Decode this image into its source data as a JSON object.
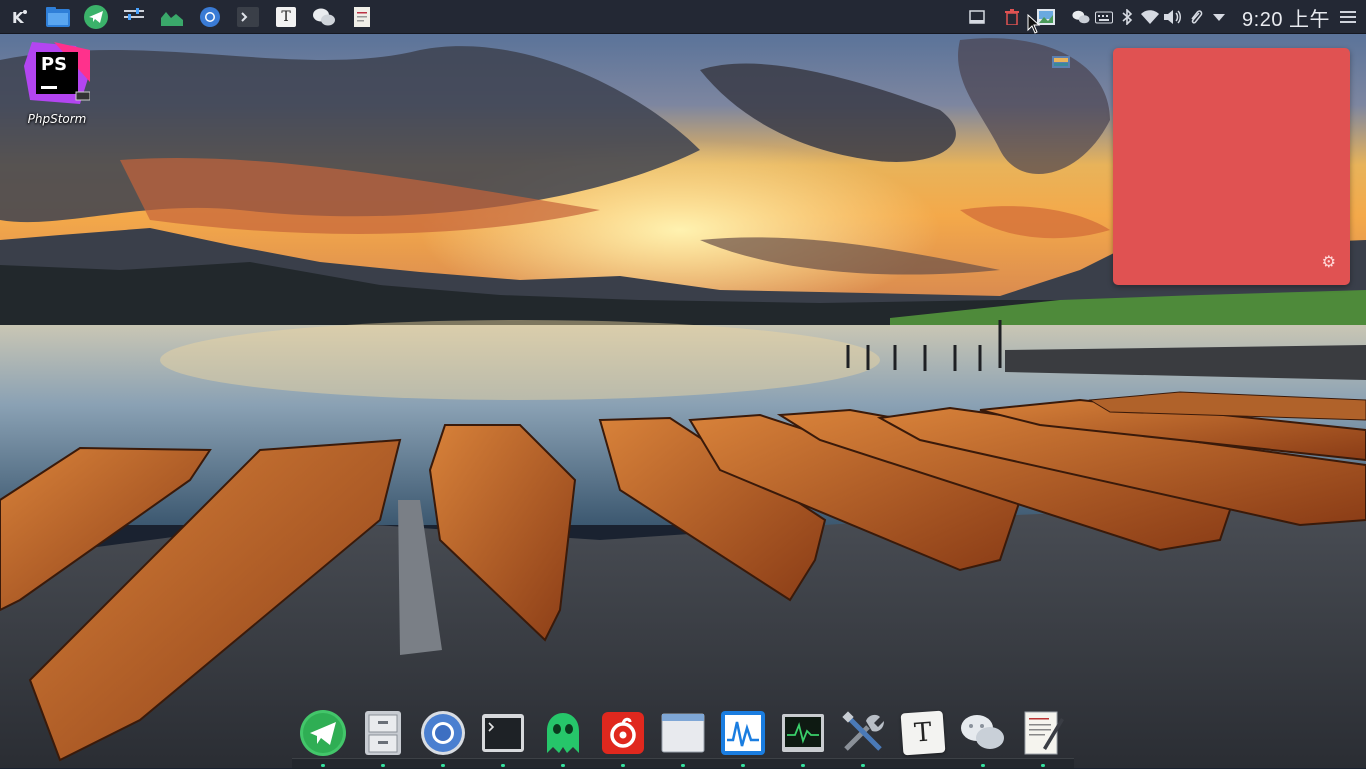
{
  "top_panel": {
    "launchers": [
      {
        "name": "kde-menu-icon"
      },
      {
        "name": "file-manager-icon"
      },
      {
        "name": "telegram-icon"
      },
      {
        "name": "system-settings-icon"
      },
      {
        "name": "system-monitor-icon"
      },
      {
        "name": "chromium-icon"
      },
      {
        "name": "terminal-icon"
      },
      {
        "name": "typora-icon",
        "glyph": "T"
      },
      {
        "name": "wechat-icon"
      },
      {
        "name": "text-editor-icon"
      }
    ],
    "tray": {
      "clock": "9:20 上午"
    }
  },
  "desktop": {
    "icons": [
      {
        "label": "PhpStorm",
        "logo_text": "PS"
      }
    ]
  },
  "dock": {
    "items": [
      {
        "name": "telegram"
      },
      {
        "name": "file-cabinet"
      },
      {
        "name": "chromium"
      },
      {
        "name": "terminal"
      },
      {
        "name": "ghost-app"
      },
      {
        "name": "netease-music"
      },
      {
        "name": "window"
      },
      {
        "name": "system-monitor-wave"
      },
      {
        "name": "activity-monitor"
      },
      {
        "name": "tools"
      },
      {
        "name": "typora",
        "glyph": "T"
      },
      {
        "name": "wechat"
      },
      {
        "name": "text-editor"
      }
    ]
  },
  "colors": {
    "panel": "#232834",
    "note_widget": "#e05252",
    "accent_green": "#35e0a0"
  }
}
